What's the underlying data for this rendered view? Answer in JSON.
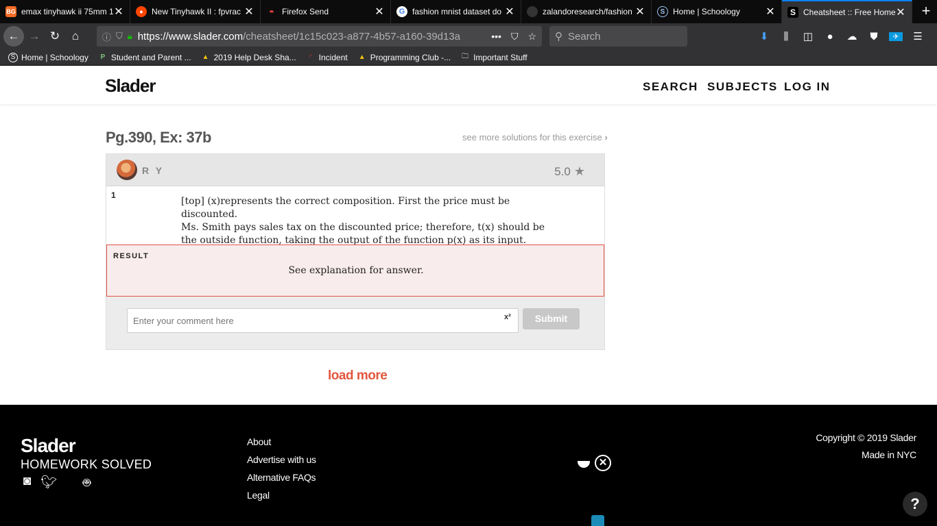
{
  "browser": {
    "tabs": [
      {
        "title": "emax tinyhawk ii 75mm 1",
        "favicon": "BG",
        "favicon_color": "#f36b24",
        "active": false
      },
      {
        "title": "New Tinyhawk II : fpvrac",
        "favicon": "reddit-icon",
        "favicon_color": "#ff4500",
        "active": false
      },
      {
        "title": "Firefox Send",
        "favicon": "send-icon",
        "favicon_color": "#e6433b",
        "active": false
      },
      {
        "title": "fashion mnist dataset do",
        "favicon": "google-icon",
        "favicon_color": "#4285f4",
        "active": false
      },
      {
        "title": "zalandoresearch/fashion",
        "favicon": "github-icon",
        "favicon_color": "#333333",
        "active": false
      },
      {
        "title": "Home | Schoology",
        "favicon": "schoology-icon",
        "favicon_color": "#3b8fd8",
        "active": false
      },
      {
        "title": "Cheatsheet :: Free Home",
        "favicon": "S",
        "favicon_color": "#ffffff",
        "active": true
      }
    ],
    "url_domain": "https://www.slader.com",
    "url_path": "/cheatsheet/1c15c023-a877-4b57-a160-39d13a",
    "search_placeholder": "Search",
    "bookmarks": [
      {
        "label": "Home | Schoology",
        "icon": "schoology-icon"
      },
      {
        "label": "Student and Parent ...",
        "icon": "p-icon"
      },
      {
        "label": "2019 Help Desk Sha...",
        "icon": "drive-icon"
      },
      {
        "label": "Incident",
        "icon": "incident-icon"
      },
      {
        "label": "Programming Club -...",
        "icon": "drive-icon"
      },
      {
        "label": "Important Stuff",
        "icon": "folder-icon"
      }
    ]
  },
  "header": {
    "logo": "Slader",
    "nav": [
      "SEARCH",
      "SUBJECTS",
      "LOG IN"
    ]
  },
  "exercise": {
    "title": "Pg.390, Ex: 37b",
    "see_more": "see more solutions for this exercise"
  },
  "solution": {
    "author": "R Y",
    "rating": "5.0",
    "step_number": "1",
    "step_lines": [
      "[top] (x)represents the correct composition. First the price must be discounted.",
      "Ms. Smith pays sales tax on the discounted price; therefore, t(x) should be",
      "the outside function, taking the output of the function p(x) as its input."
    ],
    "result_label": "RESULT",
    "result_text": "See explanation for answer.",
    "comment_placeholder": "Enter your comment here",
    "superscript_button": "x²",
    "submit_label": "Submit"
  },
  "load_more": "load more",
  "footer": {
    "logo": "Slader",
    "tagline": "HOMEWORK SOLVED",
    "links": [
      "About",
      "Advertise with us",
      "Alternative FAQs",
      "Legal"
    ],
    "copyright": "Copyright © 2019 Slader",
    "made_in": "Made in NYC",
    "help": "?"
  }
}
